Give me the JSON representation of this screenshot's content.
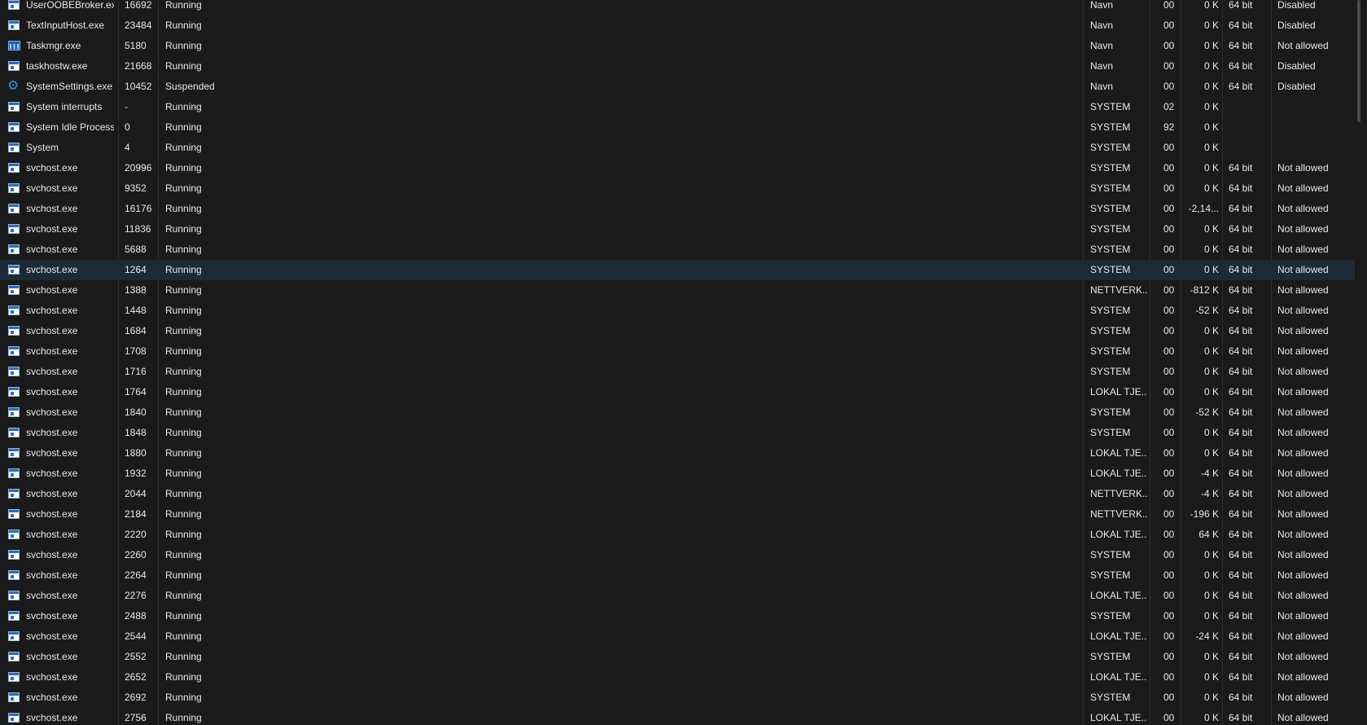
{
  "processes": [
    {
      "name": "UserOOBEBroker.exe",
      "pid": "16692",
      "status": "Running",
      "user": "Navn",
      "cpu": "00",
      "mem": "0 K",
      "arch": "64 bit",
      "uac": "Disabled",
      "icon": "window-icon"
    },
    {
      "name": "TextInputHost.exe",
      "pid": "23484",
      "status": "Running",
      "user": "Navn",
      "cpu": "00",
      "mem": "0 K",
      "arch": "64 bit",
      "uac": "Disabled",
      "icon": "window-icon"
    },
    {
      "name": "Taskmgr.exe",
      "pid": "5180",
      "status": "Running",
      "user": "Navn",
      "cpu": "00",
      "mem": "0 K",
      "arch": "64 bit",
      "uac": "Not allowed",
      "icon": "task-manager-icon"
    },
    {
      "name": "taskhostw.exe",
      "pid": "21668",
      "status": "Running",
      "user": "Navn",
      "cpu": "00",
      "mem": "0 K",
      "arch": "64 bit",
      "uac": "Disabled",
      "icon": "window-icon"
    },
    {
      "name": "SystemSettings.exe",
      "pid": "10452",
      "status": "Suspended",
      "user": "Navn",
      "cpu": "00",
      "mem": "0 K",
      "arch": "64 bit",
      "uac": "Disabled",
      "icon": "gear-icon"
    },
    {
      "name": "System interrupts",
      "pid": "-",
      "status": "Running",
      "user": "SYSTEM",
      "cpu": "02",
      "mem": "0 K",
      "arch": "",
      "uac": "",
      "icon": "window-icon"
    },
    {
      "name": "System Idle Process",
      "pid": "0",
      "status": "Running",
      "user": "SYSTEM",
      "cpu": "92",
      "mem": "0 K",
      "arch": "",
      "uac": "",
      "icon": "window-icon"
    },
    {
      "name": "System",
      "pid": "4",
      "status": "Running",
      "user": "SYSTEM",
      "cpu": "00",
      "mem": "0 K",
      "arch": "",
      "uac": "",
      "icon": "window-icon"
    },
    {
      "name": "svchost.exe",
      "pid": "20996",
      "status": "Running",
      "user": "SYSTEM",
      "cpu": "00",
      "mem": "0 K",
      "arch": "64 bit",
      "uac": "Not allowed",
      "icon": "window-icon"
    },
    {
      "name": "svchost.exe",
      "pid": "9352",
      "status": "Running",
      "user": "SYSTEM",
      "cpu": "00",
      "mem": "0 K",
      "arch": "64 bit",
      "uac": "Not allowed",
      "icon": "window-icon"
    },
    {
      "name": "svchost.exe",
      "pid": "16176",
      "status": "Running",
      "user": "SYSTEM",
      "cpu": "00",
      "mem": "-2,14...",
      "arch": "64 bit",
      "uac": "Not allowed",
      "icon": "window-icon"
    },
    {
      "name": "svchost.exe",
      "pid": "11836",
      "status": "Running",
      "user": "SYSTEM",
      "cpu": "00",
      "mem": "0 K",
      "arch": "64 bit",
      "uac": "Not allowed",
      "icon": "window-icon"
    },
    {
      "name": "svchost.exe",
      "pid": "5688",
      "status": "Running",
      "user": "SYSTEM",
      "cpu": "00",
      "mem": "0 K",
      "arch": "64 bit",
      "uac": "Not allowed",
      "icon": "window-icon"
    },
    {
      "name": "svchost.exe",
      "pid": "1264",
      "status": "Running",
      "user": "SYSTEM",
      "cpu": "00",
      "mem": "0 K",
      "arch": "64 bit",
      "uac": "Not allowed",
      "icon": "window-icon",
      "selected": true
    },
    {
      "name": "svchost.exe",
      "pid": "1388",
      "status": "Running",
      "user": "NETTVERK...",
      "cpu": "00",
      "mem": "-812 K",
      "arch": "64 bit",
      "uac": "Not allowed",
      "icon": "window-icon"
    },
    {
      "name": "svchost.exe",
      "pid": "1448",
      "status": "Running",
      "user": "SYSTEM",
      "cpu": "00",
      "mem": "-52 K",
      "arch": "64 bit",
      "uac": "Not allowed",
      "icon": "window-icon"
    },
    {
      "name": "svchost.exe",
      "pid": "1684",
      "status": "Running",
      "user": "SYSTEM",
      "cpu": "00",
      "mem": "0 K",
      "arch": "64 bit",
      "uac": "Not allowed",
      "icon": "window-icon"
    },
    {
      "name": "svchost.exe",
      "pid": "1708",
      "status": "Running",
      "user": "SYSTEM",
      "cpu": "00",
      "mem": "0 K",
      "arch": "64 bit",
      "uac": "Not allowed",
      "icon": "window-icon"
    },
    {
      "name": "svchost.exe",
      "pid": "1716",
      "status": "Running",
      "user": "SYSTEM",
      "cpu": "00",
      "mem": "0 K",
      "arch": "64 bit",
      "uac": "Not allowed",
      "icon": "window-icon"
    },
    {
      "name": "svchost.exe",
      "pid": "1764",
      "status": "Running",
      "user": "LOKAL TJE...",
      "cpu": "00",
      "mem": "0 K",
      "arch": "64 bit",
      "uac": "Not allowed",
      "icon": "window-icon"
    },
    {
      "name": "svchost.exe",
      "pid": "1840",
      "status": "Running",
      "user": "SYSTEM",
      "cpu": "00",
      "mem": "-52 K",
      "arch": "64 bit",
      "uac": "Not allowed",
      "icon": "window-icon"
    },
    {
      "name": "svchost.exe",
      "pid": "1848",
      "status": "Running",
      "user": "SYSTEM",
      "cpu": "00",
      "mem": "0 K",
      "arch": "64 bit",
      "uac": "Not allowed",
      "icon": "window-icon"
    },
    {
      "name": "svchost.exe",
      "pid": "1880",
      "status": "Running",
      "user": "LOKAL TJE...",
      "cpu": "00",
      "mem": "0 K",
      "arch": "64 bit",
      "uac": "Not allowed",
      "icon": "window-icon"
    },
    {
      "name": "svchost.exe",
      "pid": "1932",
      "status": "Running",
      "user": "LOKAL TJE...",
      "cpu": "00",
      "mem": "-4 K",
      "arch": "64 bit",
      "uac": "Not allowed",
      "icon": "window-icon"
    },
    {
      "name": "svchost.exe",
      "pid": "2044",
      "status": "Running",
      "user": "NETTVERK...",
      "cpu": "00",
      "mem": "-4 K",
      "arch": "64 bit",
      "uac": "Not allowed",
      "icon": "window-icon"
    },
    {
      "name": "svchost.exe",
      "pid": "2184",
      "status": "Running",
      "user": "NETTVERK...",
      "cpu": "00",
      "mem": "-196 K",
      "arch": "64 bit",
      "uac": "Not allowed",
      "icon": "window-icon"
    },
    {
      "name": "svchost.exe",
      "pid": "2220",
      "status": "Running",
      "user": "LOKAL TJE...",
      "cpu": "00",
      "mem": "64 K",
      "arch": "64 bit",
      "uac": "Not allowed",
      "icon": "window-icon"
    },
    {
      "name": "svchost.exe",
      "pid": "2260",
      "status": "Running",
      "user": "SYSTEM",
      "cpu": "00",
      "mem": "0 K",
      "arch": "64 bit",
      "uac": "Not allowed",
      "icon": "window-icon"
    },
    {
      "name": "svchost.exe",
      "pid": "2264",
      "status": "Running",
      "user": "SYSTEM",
      "cpu": "00",
      "mem": "0 K",
      "arch": "64 bit",
      "uac": "Not allowed",
      "icon": "window-icon"
    },
    {
      "name": "svchost.exe",
      "pid": "2276",
      "status": "Running",
      "user": "LOKAL TJE...",
      "cpu": "00",
      "mem": "0 K",
      "arch": "64 bit",
      "uac": "Not allowed",
      "icon": "window-icon"
    },
    {
      "name": "svchost.exe",
      "pid": "2488",
      "status": "Running",
      "user": "SYSTEM",
      "cpu": "00",
      "mem": "0 K",
      "arch": "64 bit",
      "uac": "Not allowed",
      "icon": "window-icon"
    },
    {
      "name": "svchost.exe",
      "pid": "2544",
      "status": "Running",
      "user": "LOKAL TJE...",
      "cpu": "00",
      "mem": "-24 K",
      "arch": "64 bit",
      "uac": "Not allowed",
      "icon": "window-icon"
    },
    {
      "name": "svchost.exe",
      "pid": "2552",
      "status": "Running",
      "user": "SYSTEM",
      "cpu": "00",
      "mem": "0 K",
      "arch": "64 bit",
      "uac": "Not allowed",
      "icon": "window-icon"
    },
    {
      "name": "svchost.exe",
      "pid": "2652",
      "status": "Running",
      "user": "LOKAL TJE...",
      "cpu": "00",
      "mem": "0 K",
      "arch": "64 bit",
      "uac": "Not allowed",
      "icon": "window-icon"
    },
    {
      "name": "svchost.exe",
      "pid": "2692",
      "status": "Running",
      "user": "SYSTEM",
      "cpu": "00",
      "mem": "0 K",
      "arch": "64 bit",
      "uac": "Not allowed",
      "icon": "window-icon"
    },
    {
      "name": "svchost.exe",
      "pid": "2756",
      "status": "Running",
      "user": "LOKAL TJE...",
      "cpu": "00",
      "mem": "0 K",
      "arch": "64 bit",
      "uac": "Not allowed",
      "icon": "window-icon"
    }
  ],
  "colors": {
    "background": "#1a1a1a",
    "text": "#e8e8e8",
    "selected_row": "#1c2a36",
    "column_separator": "#2e2e2e",
    "icon_blue": "#2b6cc4"
  }
}
